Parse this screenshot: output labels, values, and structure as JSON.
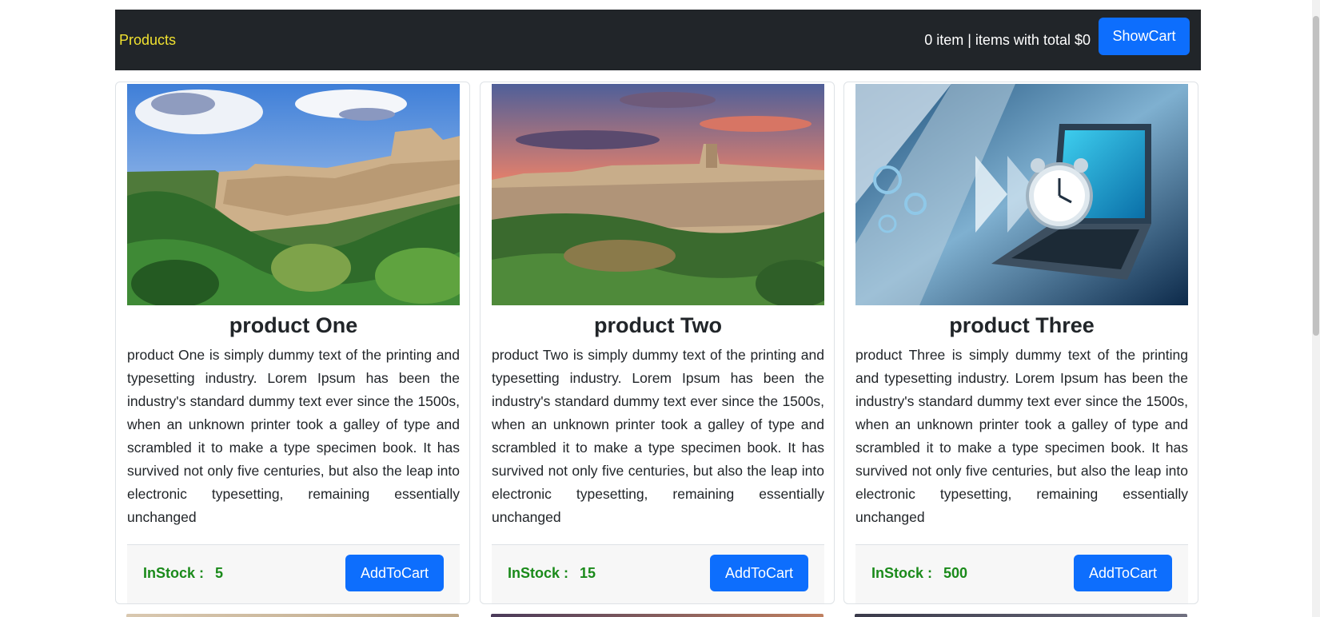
{
  "navbar": {
    "brand": "Products",
    "cart_summary": "0 item | items with total $0",
    "show_cart_label": "ShowCart"
  },
  "products": [
    {
      "title": "product One",
      "description": "product One is simply dummy text of the printing and typesetting industry. Lorem Ipsum has been the industry's standard dummy text ever since the 1500s, when an unknown printer took a galley of type and scrambled it to make a type specimen book. It has survived not only five centuries, but also the leap into electronic typesetting, remaining essentially unchanged",
      "stock_label": "InStock :",
      "stock_value": "5",
      "add_label": "AddToCart",
      "image": "hilltop-town-landscape"
    },
    {
      "title": "product Two",
      "description": "product Two is simply dummy text of the printing and typesetting industry. Lorem Ipsum has been the industry's standard dummy text ever since the 1500s, when an unknown printer took a galley of type and scrambled it to make a type specimen book. It has survived not only five centuries, but also the leap into electronic typesetting, remaining essentially unchanged",
      "stock_label": "InStock :",
      "stock_value": "15",
      "add_label": "AddToCart",
      "image": "hilltop-town-sunset"
    },
    {
      "title": "product Three",
      "description": "product Three is simply dummy text of the printing and typesetting industry. Lorem Ipsum has been the industry's standard dummy text ever since the 1500s, when an unknown printer took a galley of type and scrambled it to make a type specimen book. It has survived not only five centuries, but also the leap into electronic typesetting, remaining essentially unchanged",
      "stock_label": "InStock :",
      "stock_value": "500",
      "add_label": "AddToCart",
      "image": "laptop-with-alarm-clock"
    }
  ],
  "colors": {
    "navbar_bg": "#212529",
    "brand": "#f0e130",
    "primary": "#0d6efd",
    "stock_green": "#1a8a1a"
  }
}
